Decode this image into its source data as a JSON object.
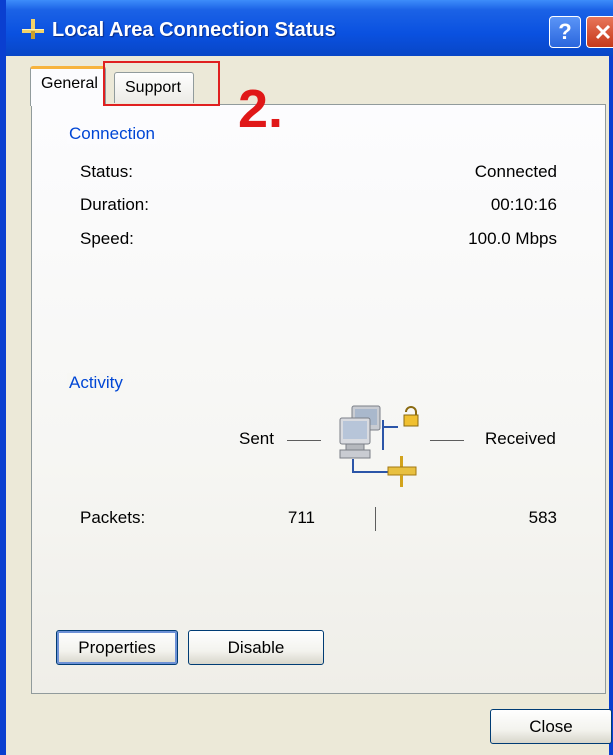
{
  "window": {
    "title": "Local Area Connection Status",
    "icon": "network-connection-icon",
    "help_button": "?",
    "close_button_icon": "close-icon"
  },
  "tabs": [
    {
      "label": "General",
      "selected": true
    },
    {
      "label": "Support",
      "selected": false
    }
  ],
  "annotation": {
    "step_label": "2.",
    "color": "#e01818"
  },
  "connection": {
    "group_title": "Connection",
    "rows": [
      {
        "label": "Status:",
        "value": "Connected"
      },
      {
        "label": "Duration:",
        "value": "00:10:16"
      },
      {
        "label": "Speed:",
        "value": "100.0 Mbps"
      }
    ]
  },
  "activity": {
    "group_title": "Activity",
    "sent_label": "Sent",
    "received_label": "Received",
    "packets_label": "Packets:",
    "packets_sent": "711",
    "packets_received": "583",
    "graphic_icon": "network-computers-lock-icon"
  },
  "buttons": {
    "properties": "Properties",
    "disable": "Disable",
    "close": "Close"
  },
  "colors": {
    "titlebar": "#0a51e0",
    "group_title": "#0046d5",
    "dialog_bg": "#ece9d8"
  }
}
